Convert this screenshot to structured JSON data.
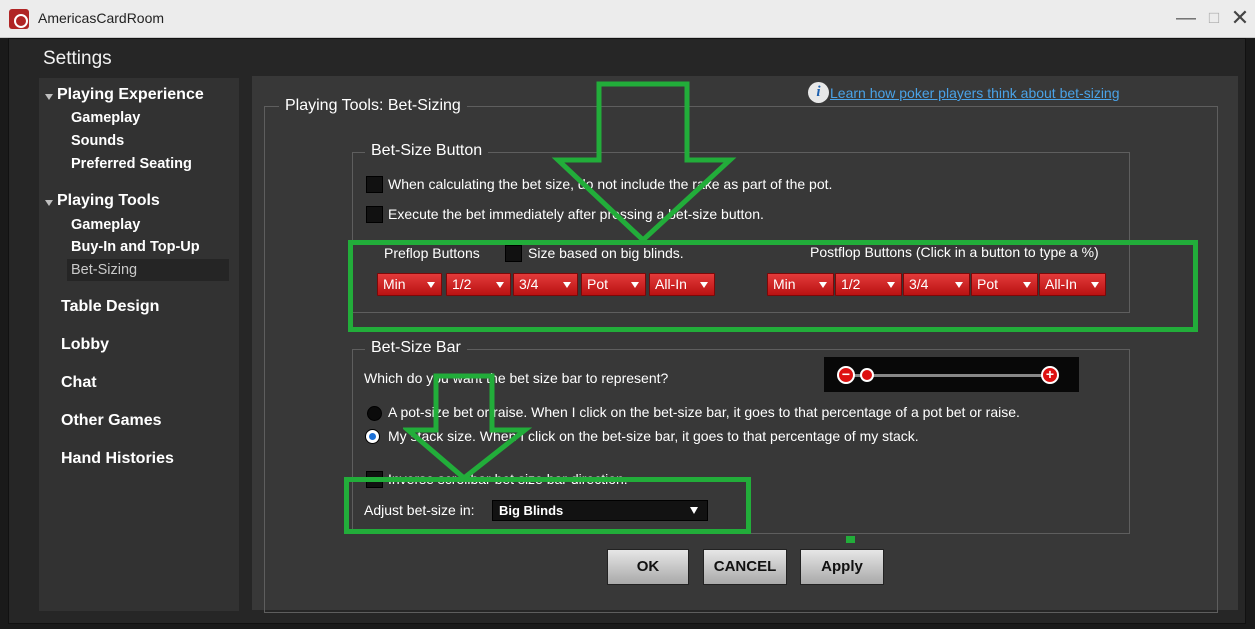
{
  "window": {
    "app_title": "AmericasCardRoom",
    "controls": [
      "minimize",
      "maximize",
      "close"
    ]
  },
  "settings_title": "Settings",
  "sidebar": {
    "playing_experience": {
      "label": "Playing Experience",
      "items": [
        "Gameplay",
        "Sounds",
        "Preferred Seating"
      ]
    },
    "playing_tools": {
      "label": "Playing Tools",
      "items": [
        "Gameplay",
        "Buy-In and Top-Up",
        "Bet-Sizing"
      ],
      "selected": "Bet-Sizing"
    },
    "main_items": [
      "Table Design",
      "Lobby",
      "Chat",
      "Other Games",
      "Hand Histories"
    ]
  },
  "content": {
    "section_title": "Playing Tools: Bet-Sizing",
    "info_icon": "i",
    "help_link": "Learn how poker players think about bet-sizing",
    "bet_size_button": {
      "legend": "Bet-Size Button",
      "option1": "When calculating the bet size, do not include the rake as part of the pot.",
      "option2": "Execute the bet immediately after pressing a bet-size button.",
      "preflop_label": "Preflop Buttons",
      "size_big_blinds": "Size based on big blinds.",
      "postflop_label": "Postflop Buttons (Click in a button to type a %)",
      "preflop_buttons": [
        "Min",
        "1/2",
        "3/4",
        "Pot",
        "All-In"
      ],
      "postflop_buttons": [
        "Min",
        "1/2",
        "3/4",
        "Pot",
        "All-In"
      ]
    },
    "bet_size_bar": {
      "legend": "Bet-Size Bar",
      "question": "Which do you want the bet size bar to represent?",
      "option_pot": "A pot-size bet or raise. When I click on the bet-size bar, it goes to that percentage of a pot bet or raise.",
      "option_stack": "My stack size. When I click on the bet-size bar, it goes to that percentage of my stack.",
      "selected": "stack",
      "inverse_label": "Inverse scrollbar bet size bar direction.",
      "adjust_label": "Adjust bet-size in:",
      "adjust_value": "Big Blinds"
    },
    "buttons": {
      "ok": "OK",
      "cancel": "CANCEL",
      "apply": "Apply"
    }
  },
  "colors": {
    "highlight_green": "#22ad3a",
    "button_red": "#d42424",
    "link_blue": "#4aa3e8"
  }
}
